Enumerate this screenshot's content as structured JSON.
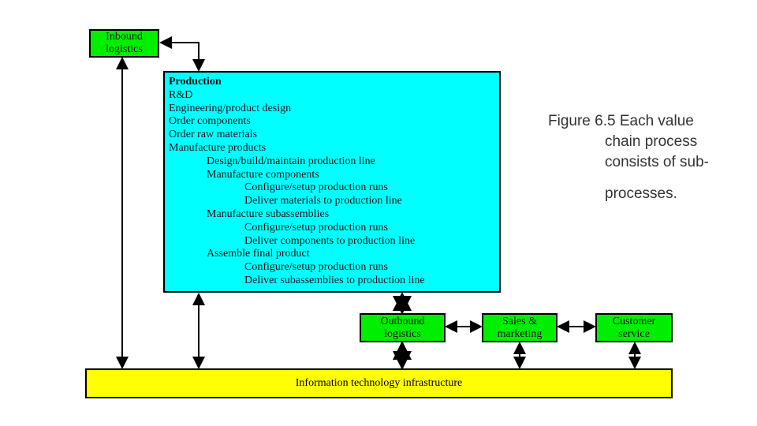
{
  "diagram": {
    "inbound": [
      "Inbound",
      "logistics"
    ],
    "production": {
      "lines": [
        {
          "text": "Production",
          "level": 0,
          "bold": true
        },
        {
          "text": "R&D",
          "level": 0
        },
        {
          "text": "Engineering/product design",
          "level": 0
        },
        {
          "text": "Order components",
          "level": 0
        },
        {
          "text": "Order raw materials",
          "level": 0
        },
        {
          "text": "Manufacture products",
          "level": 0
        },
        {
          "text": "Design/build/maintain production line",
          "level": 1
        },
        {
          "text": "Manufacture components",
          "level": 1
        },
        {
          "text": "Configure/setup production runs",
          "level": 2
        },
        {
          "text": "Deliver materials to production line",
          "level": 2
        },
        {
          "text": "Manufacture subassemblies",
          "level": 1
        },
        {
          "text": "Configure/setup production runs",
          "level": 2
        },
        {
          "text": "Deliver components to production line",
          "level": 2
        },
        {
          "text": "Assemble final product",
          "level": 1
        },
        {
          "text": "Configure/setup production runs",
          "level": 2
        },
        {
          "text": "Deliver subassemblies to production line",
          "level": 2
        }
      ]
    },
    "outbound": [
      "Outbound",
      "logistics"
    ],
    "sales": [
      "Sales &",
      "marketing"
    ],
    "customer": [
      "Customer",
      "service"
    ],
    "it": "Information technology infrastructure",
    "colors": {
      "primary_activity": "#00ee00",
      "production": "#00ffff",
      "infrastructure": "#ffff00"
    }
  },
  "caption": [
    "Figure 6.5 Each value",
    "chain process",
    "consists of sub-",
    "processes."
  ]
}
